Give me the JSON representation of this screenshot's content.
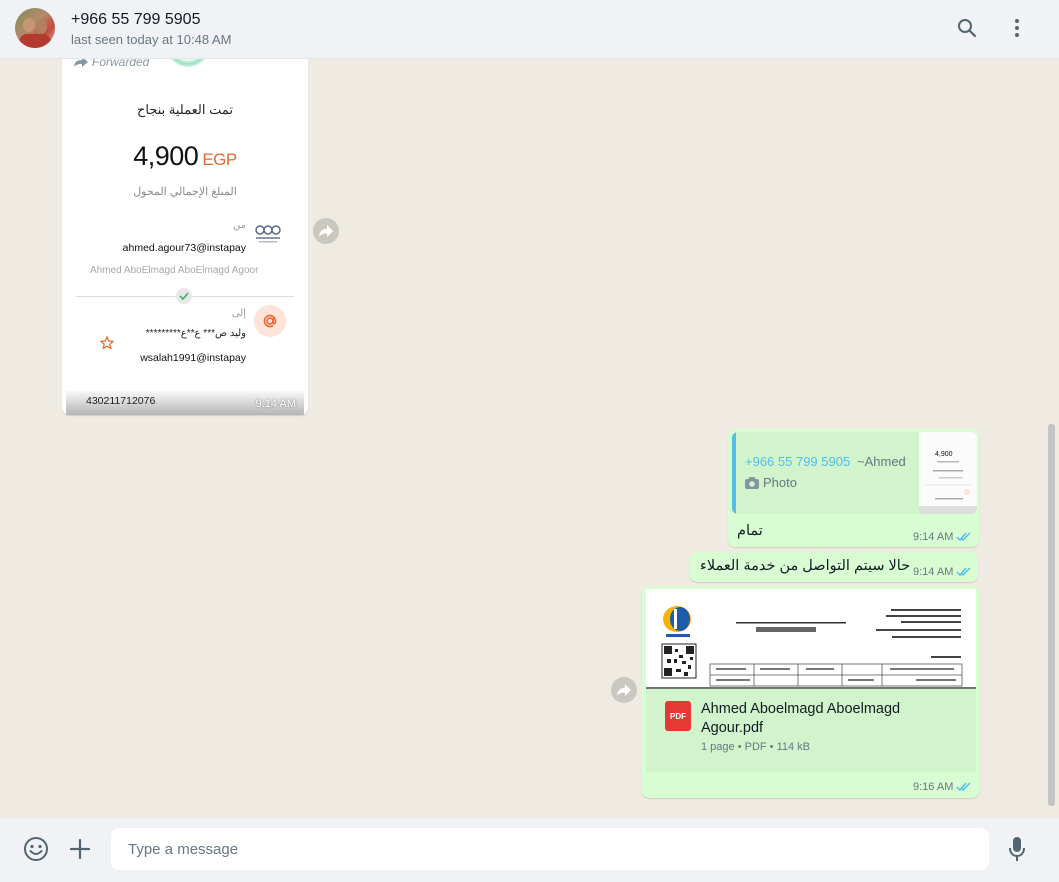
{
  "header": {
    "contact_name": "+966 55 799 5905",
    "status": "last seen today at 10:48 AM",
    "icons": [
      "search-icon",
      "menu-icon"
    ]
  },
  "incoming_image": {
    "forwarded_label": "Forwarded",
    "receipt": {
      "title": "تمت العملية بنجاح",
      "amount": "4,900",
      "currency": "EGP",
      "amount_caption": "المبلغ الإجمالي المحول",
      "from_label": "من",
      "from_id": "ahmed.agour73@instapay",
      "from_name": "Ahmed AboElmagd AboElmagd Agoor",
      "to_label": "إلى",
      "to_name": "وليد ص*** ع**ع*********",
      "to_id": "wsalah1991@instapay",
      "reference": "430211712076"
    },
    "time": "9:14 AM"
  },
  "outgoing": {
    "reply": {
      "quoted_number": "+966 55 799 5905",
      "quoted_author": "~Ahmed",
      "quoted_type": "Photo",
      "text": "تمام",
      "time": "9:14 AM"
    },
    "message2": {
      "text": "حالا سيتم التواصل من خدمة العملاء",
      "time": "9:14 AM"
    },
    "document": {
      "file_name": "Ahmed Aboelmagd Aboelmagd Agour.pdf",
      "meta": "1 page • PDF • 114 kB",
      "time": "9:16 AM",
      "pdf_label": "PDF"
    }
  },
  "composer": {
    "placeholder": "Type a message"
  },
  "colors": {
    "outgoing_bubble": "#d9fdd3",
    "accent_blue": "#53bdeb",
    "brand_green": "#00a884",
    "amount_currency": "#e8672f"
  }
}
